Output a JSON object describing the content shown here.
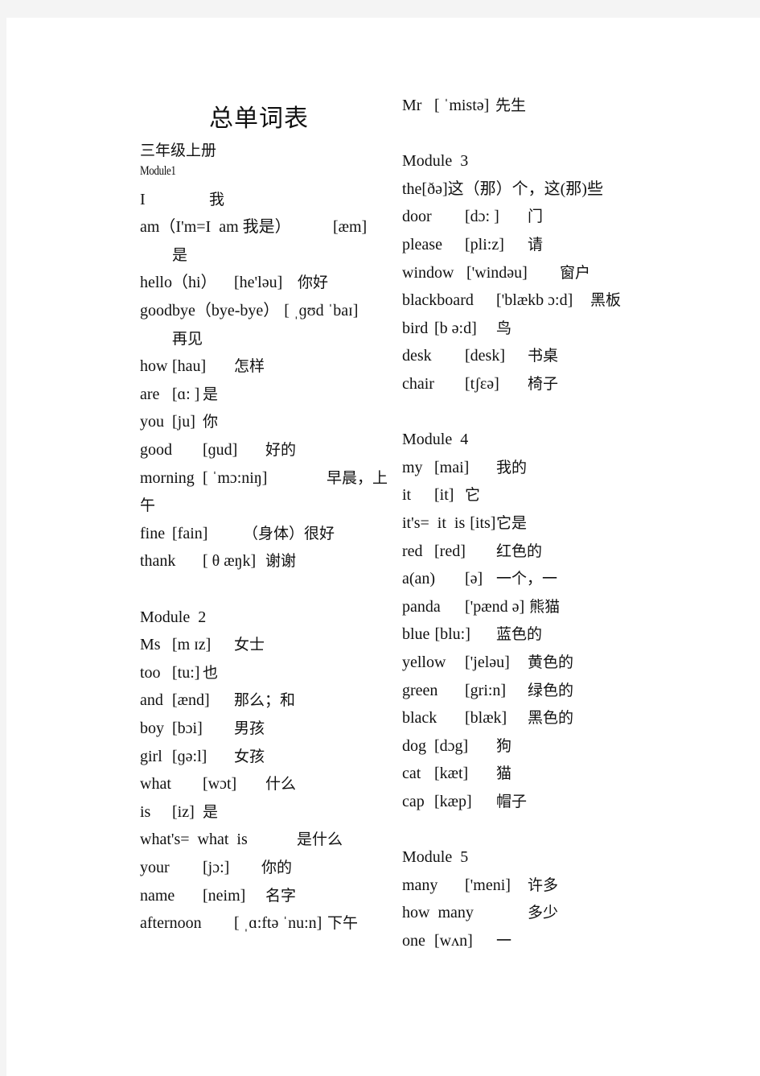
{
  "document": {
    "title": "总单词表",
    "grade": "三年级上册",
    "left_column": [
      {
        "kind": "module",
        "label": "Module1"
      },
      {
        "kind": "word",
        "word": "I",
        "ipa": "",
        "meaning": "我"
      },
      {
        "kind": "word",
        "word": "am（I'm=I  am 我是）",
        "ipa": "[æm]",
        "meaning": ""
      },
      {
        "kind": "cont",
        "text": "是"
      },
      {
        "kind": "word",
        "word": "hello（hi）",
        "ipa": "[he'ləu]",
        "meaning": "你好"
      },
      {
        "kind": "word",
        "word": "goodbye（bye-bye）",
        "ipa": "[ ˌɡʊd ˈbaɪ]",
        "meaning": ""
      },
      {
        "kind": "cont",
        "text": "再见"
      },
      {
        "kind": "word",
        "word": "how",
        "ipa": "[hau]",
        "meaning": "怎样"
      },
      {
        "kind": "word",
        "word": "are",
        "ipa": "[ɑ: ]",
        "meaning": "是"
      },
      {
        "kind": "word",
        "word": "you",
        "ipa": "[ju]",
        "meaning": "你"
      },
      {
        "kind": "word",
        "word": "good",
        "ipa": "[ɡud]",
        "meaning": "好的"
      },
      {
        "kind": "word",
        "word": "morning",
        "ipa": "[ ˈmɔ:niŋ]",
        "meaning": "早晨，上"
      },
      {
        "kind": "cont0",
        "text": "午"
      },
      {
        "kind": "word",
        "word": "fine",
        "ipa": "[fain]",
        "meaning": "（身体）很好"
      },
      {
        "kind": "word",
        "word": "thank",
        "ipa": "[ θ æŋk]",
        "meaning": "谢谢"
      },
      {
        "kind": "blank"
      },
      {
        "kind": "module",
        "label": "Module  2"
      },
      {
        "kind": "word",
        "word": "Ms",
        "ipa": "[m ɪz]",
        "meaning": "女士"
      },
      {
        "kind": "word",
        "word": "too",
        "ipa": "[tu:]",
        "meaning": "也"
      },
      {
        "kind": "word",
        "word": "and",
        "ipa": "[ænd]",
        "meaning": "那么；和"
      },
      {
        "kind": "word",
        "word": "boy",
        "ipa": "[bɔi]",
        "meaning": "男孩"
      },
      {
        "kind": "word",
        "word": "girl",
        "ipa": "[ɡə:l]",
        "meaning": "女孩"
      },
      {
        "kind": "word",
        "word": "what",
        "ipa": "[wɔt]",
        "meaning": "什么"
      },
      {
        "kind": "word",
        "word": "is",
        "ipa": "[iz]",
        "meaning": "是"
      },
      {
        "kind": "word",
        "word": "what's=  what  is",
        "ipa": "",
        "meaning": "是什么"
      },
      {
        "kind": "word",
        "word": "your",
        "ipa": "[jɔ:]",
        "meaning": "你的"
      },
      {
        "kind": "word",
        "word": "name",
        "ipa": "[neim]",
        "meaning": "名字"
      },
      {
        "kind": "word",
        "word": "afternoon",
        "ipa": "[ ˌɑ:ftə ˈnu:n]",
        "meaning": "下午"
      }
    ],
    "right_column": [
      {
        "kind": "word",
        "word": "Mr",
        "ipa": "[ ˈmistə]",
        "meaning": "先生"
      },
      {
        "kind": "blank"
      },
      {
        "kind": "module",
        "label": "Module  3"
      },
      {
        "kind": "word",
        "word": "the[ðə]这（那）个，这(那)些",
        "ipa": "",
        "meaning": ""
      },
      {
        "kind": "word",
        "word": "door",
        "ipa": "[dɔ: ]",
        "meaning": "门"
      },
      {
        "kind": "word",
        "word": "please",
        "ipa": "[pli:z]",
        "meaning": "请"
      },
      {
        "kind": "word",
        "word": "window",
        "ipa": "['windəu]",
        "meaning": "窗户"
      },
      {
        "kind": "word",
        "word": "blackboard",
        "ipa": "['blækb ɔ:d]",
        "meaning": "黑板"
      },
      {
        "kind": "word",
        "word": "bird",
        "ipa": "[b ə:d]",
        "meaning": "鸟"
      },
      {
        "kind": "word",
        "word": "desk",
        "ipa": "[desk]",
        "meaning": "书桌"
      },
      {
        "kind": "word",
        "word": "chair",
        "ipa": "[tʃɛə]",
        "meaning": "椅子"
      },
      {
        "kind": "blank"
      },
      {
        "kind": "module",
        "label": "Module  4"
      },
      {
        "kind": "word",
        "word": "my",
        "ipa": "[mai]",
        "meaning": "我的"
      },
      {
        "kind": "word",
        "word": "it",
        "ipa": "[it]",
        "meaning": "它"
      },
      {
        "kind": "word",
        "word": "it's=  it  is",
        "ipa": "[its]",
        "meaning": "它是"
      },
      {
        "kind": "word",
        "word": "red",
        "ipa": "[red]",
        "meaning": "红色的"
      },
      {
        "kind": "word",
        "word": "a(an)",
        "ipa": "[ə]",
        "meaning": "一个，一"
      },
      {
        "kind": "word",
        "word": "panda",
        "ipa": "['pænd ə]",
        "meaning": "熊猫"
      },
      {
        "kind": "word",
        "word": "blue",
        "ipa": "[blu:]",
        "meaning": "蓝色的"
      },
      {
        "kind": "word",
        "word": "yellow",
        "ipa": "['jeləu]",
        "meaning": "黄色的"
      },
      {
        "kind": "word",
        "word": "green",
        "ipa": "[gri:n]",
        "meaning": "绿色的"
      },
      {
        "kind": "word",
        "word": "black",
        "ipa": "[blæk]",
        "meaning": "黑色的"
      },
      {
        "kind": "word",
        "word": "dog",
        "ipa": "[dɔg]",
        "meaning": "狗"
      },
      {
        "kind": "word",
        "word": "cat",
        "ipa": "[kæt]",
        "meaning": "猫"
      },
      {
        "kind": "word",
        "word": "cap",
        "ipa": "[kæp]",
        "meaning": "帽子"
      },
      {
        "kind": "blank"
      },
      {
        "kind": "module",
        "label": "Module  5"
      },
      {
        "kind": "word",
        "word": "many",
        "ipa": "['meni]",
        "meaning": "许多"
      },
      {
        "kind": "word",
        "word": "how  many",
        "ipa": "",
        "meaning": "多少"
      },
      {
        "kind": "word",
        "word": "one",
        "ipa": "[wʌn]",
        "meaning": "一"
      }
    ]
  }
}
